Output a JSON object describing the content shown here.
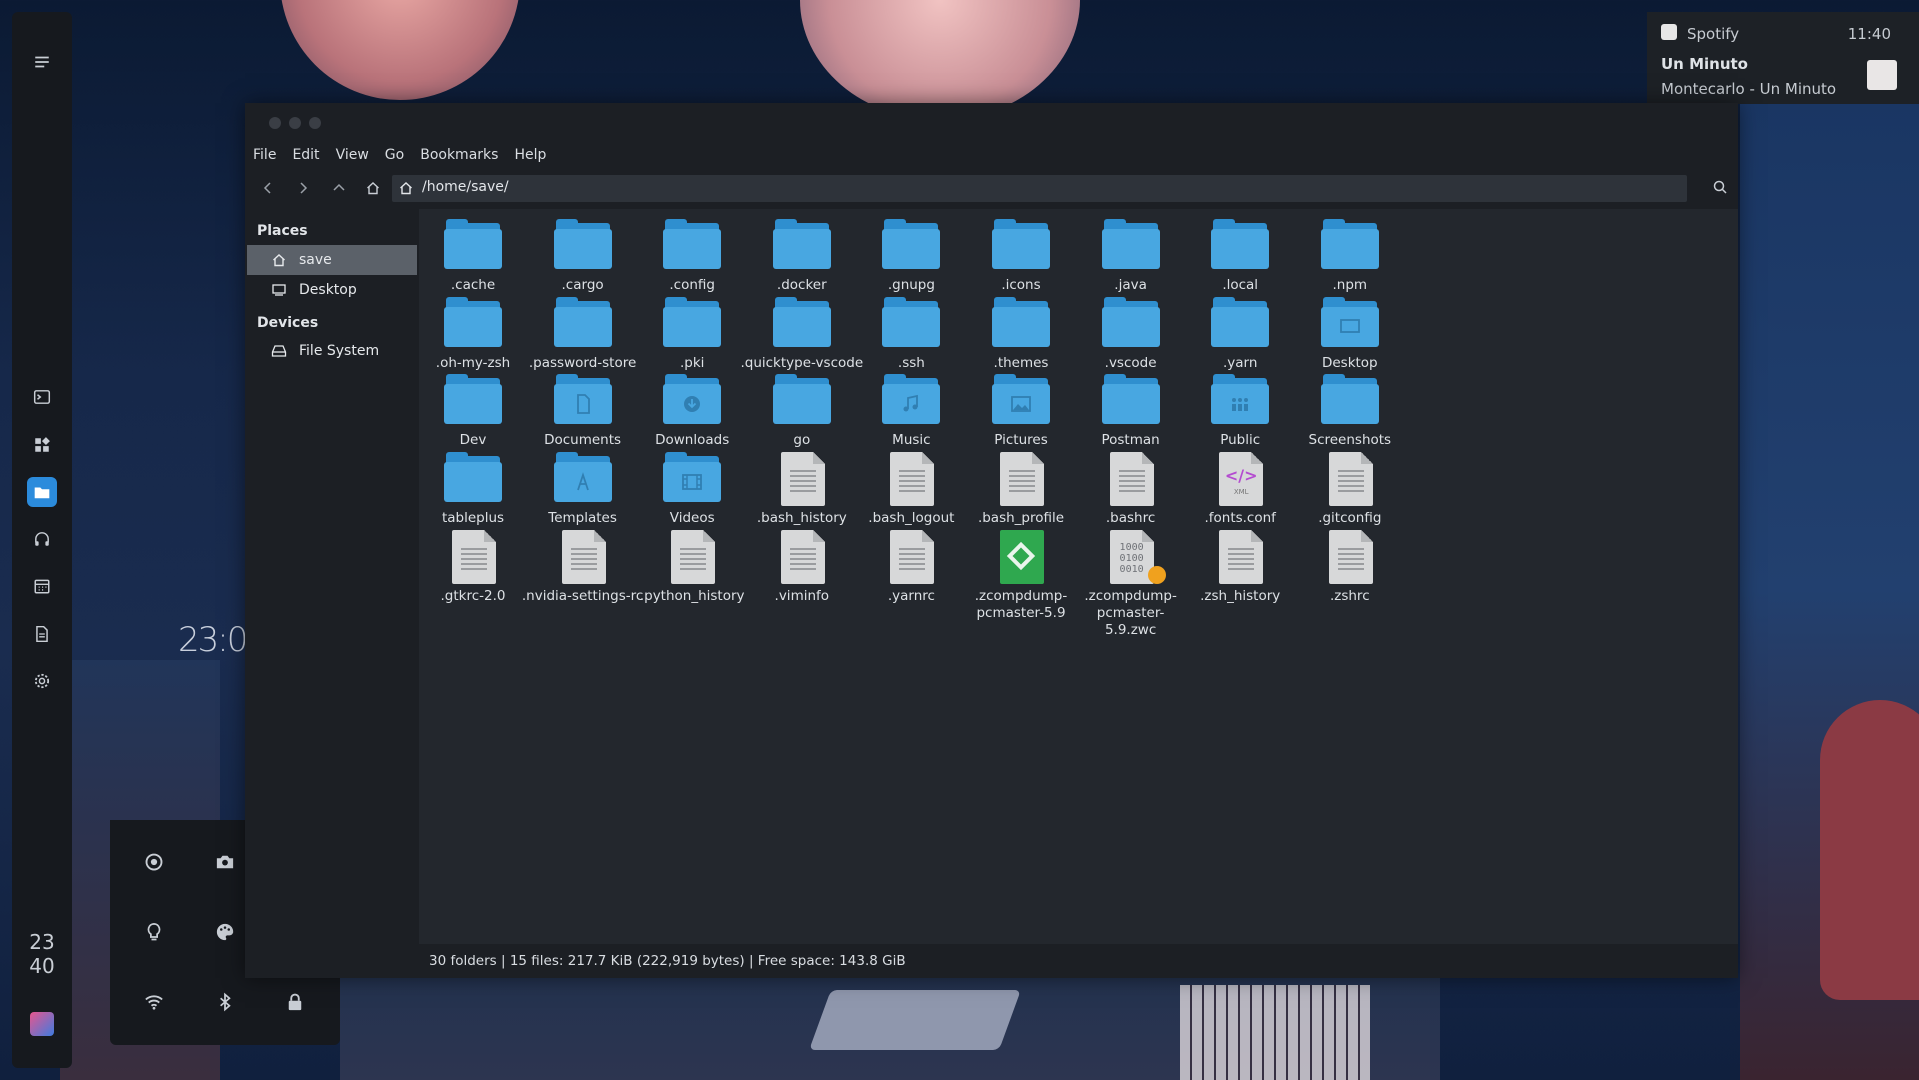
{
  "notification": {
    "app": "Spotify",
    "time": "11:40",
    "title": "Un Minuto",
    "body": "Montecarlo - Un Minuto"
  },
  "dock": {
    "clock_hours": "23",
    "clock_minutes": "40",
    "accent": "#2b8bdc"
  },
  "wallpaper": {
    "clock": "23:0"
  },
  "window": {
    "menu": [
      "File",
      "Edit",
      "View",
      "Go",
      "Bookmarks",
      "Help"
    ],
    "location": "/home/save/",
    "sidebar": {
      "places_heading": "Places",
      "places": [
        "save",
        "Desktop"
      ],
      "devices_heading": "Devices",
      "devices": [
        "File System"
      ]
    },
    "items": [
      {
        "name": ".cache",
        "kind": "folder"
      },
      {
        "name": ".cargo",
        "kind": "folder"
      },
      {
        "name": ".config",
        "kind": "folder"
      },
      {
        "name": ".docker",
        "kind": "folder"
      },
      {
        "name": ".gnupg",
        "kind": "folder"
      },
      {
        "name": ".icons",
        "kind": "folder"
      },
      {
        "name": ".java",
        "kind": "folder"
      },
      {
        "name": ".local",
        "kind": "folder"
      },
      {
        "name": ".npm",
        "kind": "folder"
      },
      {
        "name": ".oh-my-zsh",
        "kind": "folder"
      },
      {
        "name": ".password-store",
        "kind": "folder"
      },
      {
        "name": ".pki",
        "kind": "folder"
      },
      {
        "name": ".quicktype-vscode",
        "kind": "folder"
      },
      {
        "name": ".ssh",
        "kind": "folder"
      },
      {
        "name": ".themes",
        "kind": "folder"
      },
      {
        "name": ".vscode",
        "kind": "folder"
      },
      {
        "name": ".yarn",
        "kind": "folder"
      },
      {
        "name": "Desktop",
        "kind": "folder",
        "emblem": "desktop-icon"
      },
      {
        "name": "Dev",
        "kind": "folder"
      },
      {
        "name": "Documents",
        "kind": "folder",
        "emblem": "document-icon"
      },
      {
        "name": "Downloads",
        "kind": "folder",
        "emblem": "download-icon"
      },
      {
        "name": "go",
        "kind": "folder"
      },
      {
        "name": "Music",
        "kind": "folder",
        "emblem": "music-note-icon"
      },
      {
        "name": "Pictures",
        "kind": "folder",
        "emblem": "picture-icon"
      },
      {
        "name": "Postman",
        "kind": "folder"
      },
      {
        "name": "Public",
        "kind": "folder",
        "emblem": "people-icon"
      },
      {
        "name": "Screenshots",
        "kind": "folder"
      },
      {
        "name": "tableplus",
        "kind": "folder"
      },
      {
        "name": "Templates",
        "kind": "folder",
        "emblem": "template-icon"
      },
      {
        "name": "Videos",
        "kind": "folder",
        "emblem": "film-icon"
      },
      {
        "name": ".bash_history",
        "kind": "text"
      },
      {
        "name": ".bash_logout",
        "kind": "text"
      },
      {
        "name": ".bash_profile",
        "kind": "text"
      },
      {
        "name": ".bashrc",
        "kind": "text"
      },
      {
        "name": ".fonts.conf",
        "kind": "xml"
      },
      {
        "name": ".gitconfig",
        "kind": "text"
      },
      {
        "name": ".gtkrc-2.0",
        "kind": "text"
      },
      {
        "name": ".nvidia-settings-rc",
        "kind": "text"
      },
      {
        "name": ".python_history",
        "kind": "text"
      },
      {
        "name": ".viminfo",
        "kind": "text"
      },
      {
        "name": ".yarnrc",
        "kind": "text"
      },
      {
        "name": ".zcompdump-pcmaster-5.9",
        "kind": "green"
      },
      {
        "name": ".zcompdump-pcmaster-5.9.zwc",
        "kind": "binary"
      },
      {
        "name": ".zsh_history",
        "kind": "text"
      },
      {
        "name": ".zshrc",
        "kind": "text"
      }
    ],
    "xml_glyph": "</>",
    "xml_sub": "XML",
    "binary_glyph": "1000\n0100\n0010",
    "status": "30 folders  |  15 files: 217.7 KiB (222,919 bytes)  |  Free space: 143.8 GiB",
    "folder_color": "#48a7e1"
  }
}
